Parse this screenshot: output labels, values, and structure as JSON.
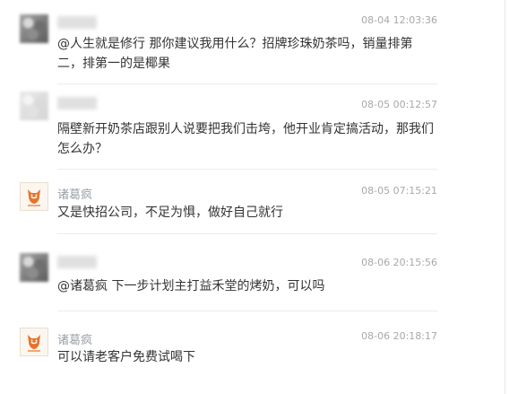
{
  "comments": [
    {
      "name": "",
      "time": "08-04 12:03:36",
      "text": "@人生就是修行 那你建议我用什么？招牌珍珠奶茶吗，销量排第二，排第一的是椰果"
    },
    {
      "name": "",
      "time": "08-05 00:12:57",
      "text": "隔壁新开奶茶店跟别人说要把我们击垮，他开业肯定搞活动，那我们怎么办？"
    },
    {
      "name": "诸葛疯",
      "time": "08-05 07:15:21",
      "text": "又是快招公司，不足为惧，做好自己就行"
    },
    {
      "name": "",
      "time": "08-06 20:15:56",
      "text": "@诸葛疯 下一步计划主打益禾堂的烤奶，可以吗"
    },
    {
      "name": "诸葛疯",
      "time": "08-06 20:18:17",
      "text": "可以请老客户免费试喝下"
    }
  ]
}
